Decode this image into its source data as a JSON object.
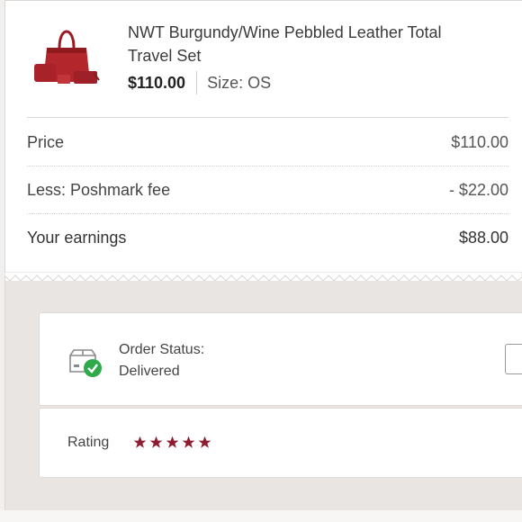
{
  "item": {
    "title": "NWT Burgundy/Wine Pebbled Leather Total Travel Set",
    "price": "$110.00",
    "size": "Size: OS"
  },
  "summary": {
    "rows": [
      {
        "label": "Price",
        "amount": "$110.00"
      },
      {
        "label": "Less: Poshmark fee",
        "amount": "- $22.00"
      },
      {
        "label": "Your earnings",
        "amount": "$88.00"
      }
    ]
  },
  "order": {
    "status_label": "Order Status:",
    "status_value": "Delivered"
  },
  "rating": {
    "label": "Rating",
    "stars": 5
  },
  "colors": {
    "accent": "#8c1c2e",
    "delivered_check": "#2eaa4a"
  },
  "icons": {
    "status": "package-delivered-icon",
    "star": "star-icon"
  }
}
